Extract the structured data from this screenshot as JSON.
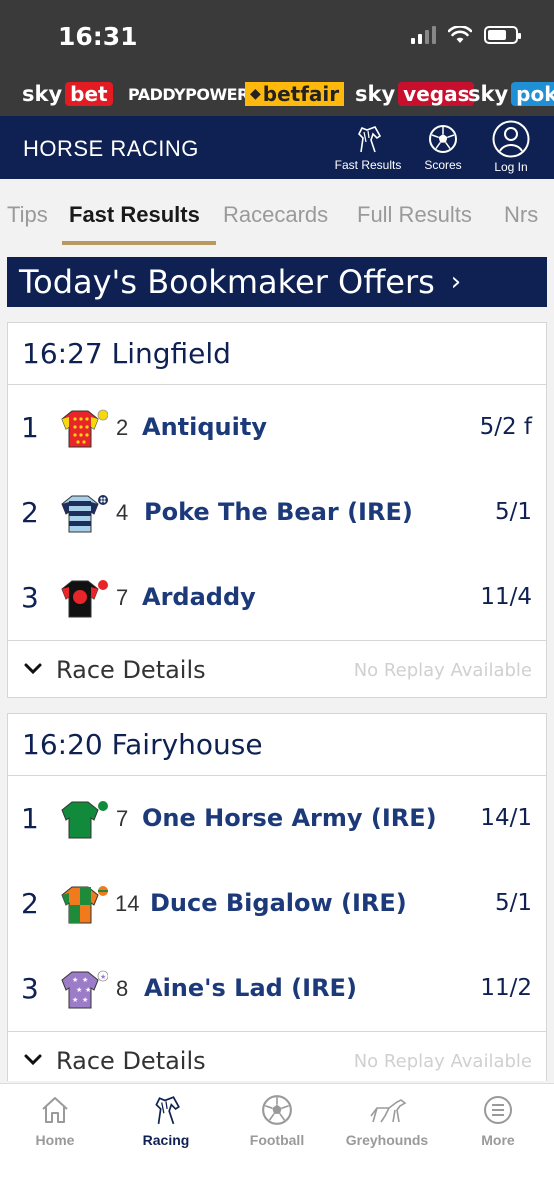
{
  "status": {
    "time": "16:31"
  },
  "brands": {
    "skybet": {
      "sky": "sky",
      "pill": "bet"
    },
    "paddypower": "PADDYPOWER",
    "betfair": "betfair",
    "skyvegas": {
      "sky": "sky",
      "pill": "vegas"
    },
    "skypoker": {
      "sky": "sky",
      "pill": "poke"
    }
  },
  "header": {
    "title": "HORSE RACING",
    "fast_results": "Fast Results",
    "scores": "Scores",
    "login": "Log In"
  },
  "tabs": [
    "Tips",
    "Fast Results",
    "Racecards",
    "Full Results",
    "Nrs"
  ],
  "offers_banner": "Today's Bookmaker Offers",
  "races": [
    {
      "title": "16:27 Lingfield",
      "runners": [
        {
          "pos": "1",
          "num": "2",
          "name": "Antiquity",
          "odds": "5/2 f"
        },
        {
          "pos": "2",
          "num": "4",
          "name": "Poke The Bear (IRE)",
          "odds": "5/1"
        },
        {
          "pos": "3",
          "num": "7",
          "name": "Ardaddy",
          "odds": "11/4"
        }
      ],
      "details_label": "Race Details",
      "replay": "No Replay Available"
    },
    {
      "title": "16:20 Fairyhouse",
      "runners": [
        {
          "pos": "1",
          "num": "7",
          "name": "One Horse Army (IRE)",
          "odds": "14/1"
        },
        {
          "pos": "2",
          "num": "14",
          "name": "Duce Bigalow (IRE)",
          "odds": "5/1"
        },
        {
          "pos": "3",
          "num": "8",
          "name": "Aine's Lad (IRE)",
          "odds": "11/2"
        }
      ],
      "details_label": "Race Details",
      "replay": "No Replay Available"
    }
  ],
  "bottom_nav": [
    "Home",
    "Racing",
    "Football",
    "Greyhounds",
    "More"
  ],
  "colors": {
    "navy": "#0e2152",
    "accent_gold": "#b89a5e",
    "link_blue": "#1c3a7a"
  }
}
